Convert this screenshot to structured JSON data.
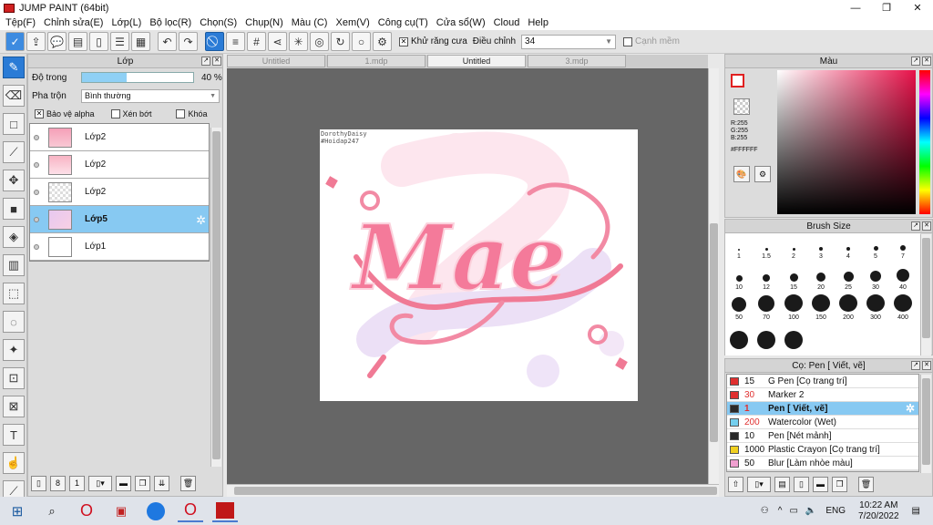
{
  "app": {
    "title": "JUMP PAINT (64bit)"
  },
  "menu": [
    "Tệp(F)",
    "Chỉnh sửa(E)",
    "Lớp(L)",
    "Bộ lọc(R)",
    "Chọn(S)",
    "Chụp(N)",
    "Màu (C)",
    "Xem(V)",
    "Công cụ(T)",
    "Cửa sổ(W)",
    "Cloud",
    "Help"
  ],
  "toolbar": {
    "antialias_label": "Khử răng cưa",
    "adjust_label": "Điều chỉnh",
    "adjust_value": "34",
    "smooth_label": "Cạnh mềm"
  },
  "layers_panel": {
    "title": "Lớp",
    "opacity_label": "Độ trong",
    "opacity_value": "40 %",
    "opacity_fraction": 0.4,
    "blend_label": "Pha trộn",
    "blend_value": "Bình thường",
    "protect_alpha": "Bảo vệ alpha",
    "clipping": "Xén bớt",
    "lock": "Khóa",
    "layers": [
      {
        "name": "Lớp2",
        "selected": false
      },
      {
        "name": "Lớp2",
        "selected": false
      },
      {
        "name": "Lớp2",
        "selected": false
      },
      {
        "name": "Lớp5",
        "selected": true
      },
      {
        "name": "Lớp1",
        "selected": false
      }
    ]
  },
  "tabs": [
    {
      "label": "Untitled",
      "selected": false
    },
    {
      "label": "1.mdp",
      "selected": false
    },
    {
      "label": "Untitled",
      "selected": true
    },
    {
      "label": "3.mdp",
      "selected": false
    }
  ],
  "canvas": {
    "watermark1": "DorothyDaisy",
    "watermark2": "#Hoidap247",
    "art_text": "Mae"
  },
  "color_panel": {
    "title": "Màu",
    "r": "R:255",
    "g": "G:255",
    "b": "B:255",
    "hex": "#FFFFFF"
  },
  "brush_size_panel": {
    "title": "Brush Size",
    "sizes": [
      "1",
      "1.5",
      "2",
      "3",
      "4",
      "5",
      "7",
      "10",
      "12",
      "15",
      "20",
      "25",
      "30",
      "40",
      "50",
      "70",
      "100",
      "150",
      "200",
      "300",
      "400",
      "",
      "",
      ""
    ]
  },
  "brush_panel": {
    "title": "Cọ: Pen [ Viết, vẽ]",
    "brushes": [
      {
        "size": "15",
        "name": "G Pen [Cọ trang trí]",
        "color": "#e03030",
        "selected": false
      },
      {
        "size": "30",
        "name": "Marker 2",
        "color": "#e03030",
        "selected": false
      },
      {
        "size": "1",
        "name": "Pen [ Viết, vẽ]",
        "color": "#2a2a2a",
        "selected": true
      },
      {
        "size": "200",
        "name": "Watercolor (Wet)",
        "color": "#74cfee",
        "selected": false
      },
      {
        "size": "10",
        "name": "Pen [Nét mảnh]",
        "color": "#2a2a2a",
        "selected": false
      },
      {
        "size": "1000",
        "name": "Plastic Crayon [Cọ trang trí]",
        "color": "#f0d020",
        "selected": false
      },
      {
        "size": "50",
        "name": "Blur [Làm nhòe màu]",
        "color": "#f0a0d0",
        "selected": false
      }
    ]
  },
  "taskbar": {
    "lang": "ENG",
    "time": "10:22 AM",
    "date": "7/20/2022"
  }
}
